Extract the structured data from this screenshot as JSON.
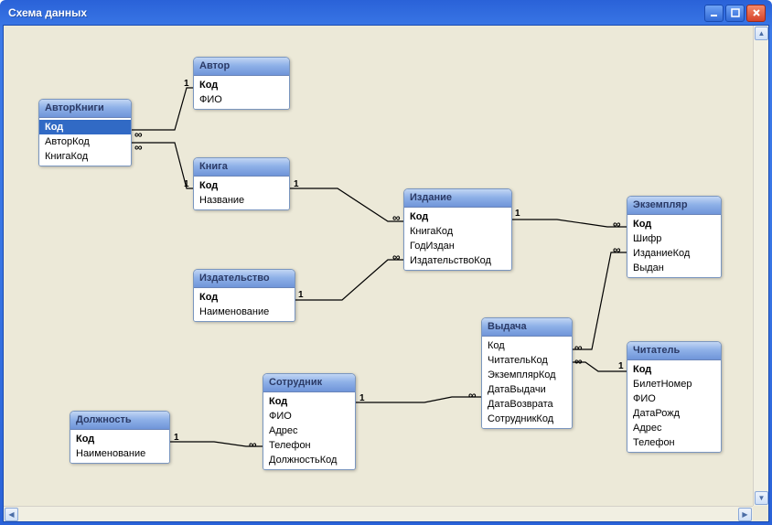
{
  "window": {
    "title": "Схема данных"
  },
  "tables": {
    "avtorKnigi": {
      "title": "АвторКниги",
      "fields": [
        "Код",
        "АвторКод",
        "КнигаКод"
      ]
    },
    "avtor": {
      "title": "Автор",
      "fields": [
        "Код",
        "ФИО"
      ]
    },
    "kniga": {
      "title": "Книга",
      "fields": [
        "Код",
        "Название"
      ]
    },
    "izdatelstvo": {
      "title": "Издательство",
      "fields": [
        "Код",
        "Наименование"
      ]
    },
    "izdanie": {
      "title": "Издание",
      "fields": [
        "Код",
        "КнигаКод",
        "ГодИздан",
        "ИздательствоКод"
      ]
    },
    "ekzemplyar": {
      "title": "Экземпляр",
      "fields": [
        "Код",
        "Шифр",
        "ИзданиеКод",
        "Выдан"
      ]
    },
    "dolzhnost": {
      "title": "Должность",
      "fields": [
        "Код",
        "Наименование"
      ]
    },
    "sotrudnik": {
      "title": "Сотрудник",
      "fields": [
        "Код",
        "ФИО",
        "Адрес",
        "Телефон",
        "ДолжностьКод"
      ]
    },
    "vydacha": {
      "title": "Выдача",
      "fields": [
        "Код",
        "ЧитательКод",
        "ЭкземплярКод",
        "ДатаВыдачи",
        "ДатаВозврата",
        "СотрудникКод"
      ]
    },
    "chitatel": {
      "title": "Читатель",
      "fields": [
        "Код",
        "БилетНомер",
        "ФИО",
        "ДатаРожд",
        "Адрес",
        "Телефон"
      ]
    }
  },
  "cardinality": {
    "one": "1",
    "many": "∞"
  }
}
